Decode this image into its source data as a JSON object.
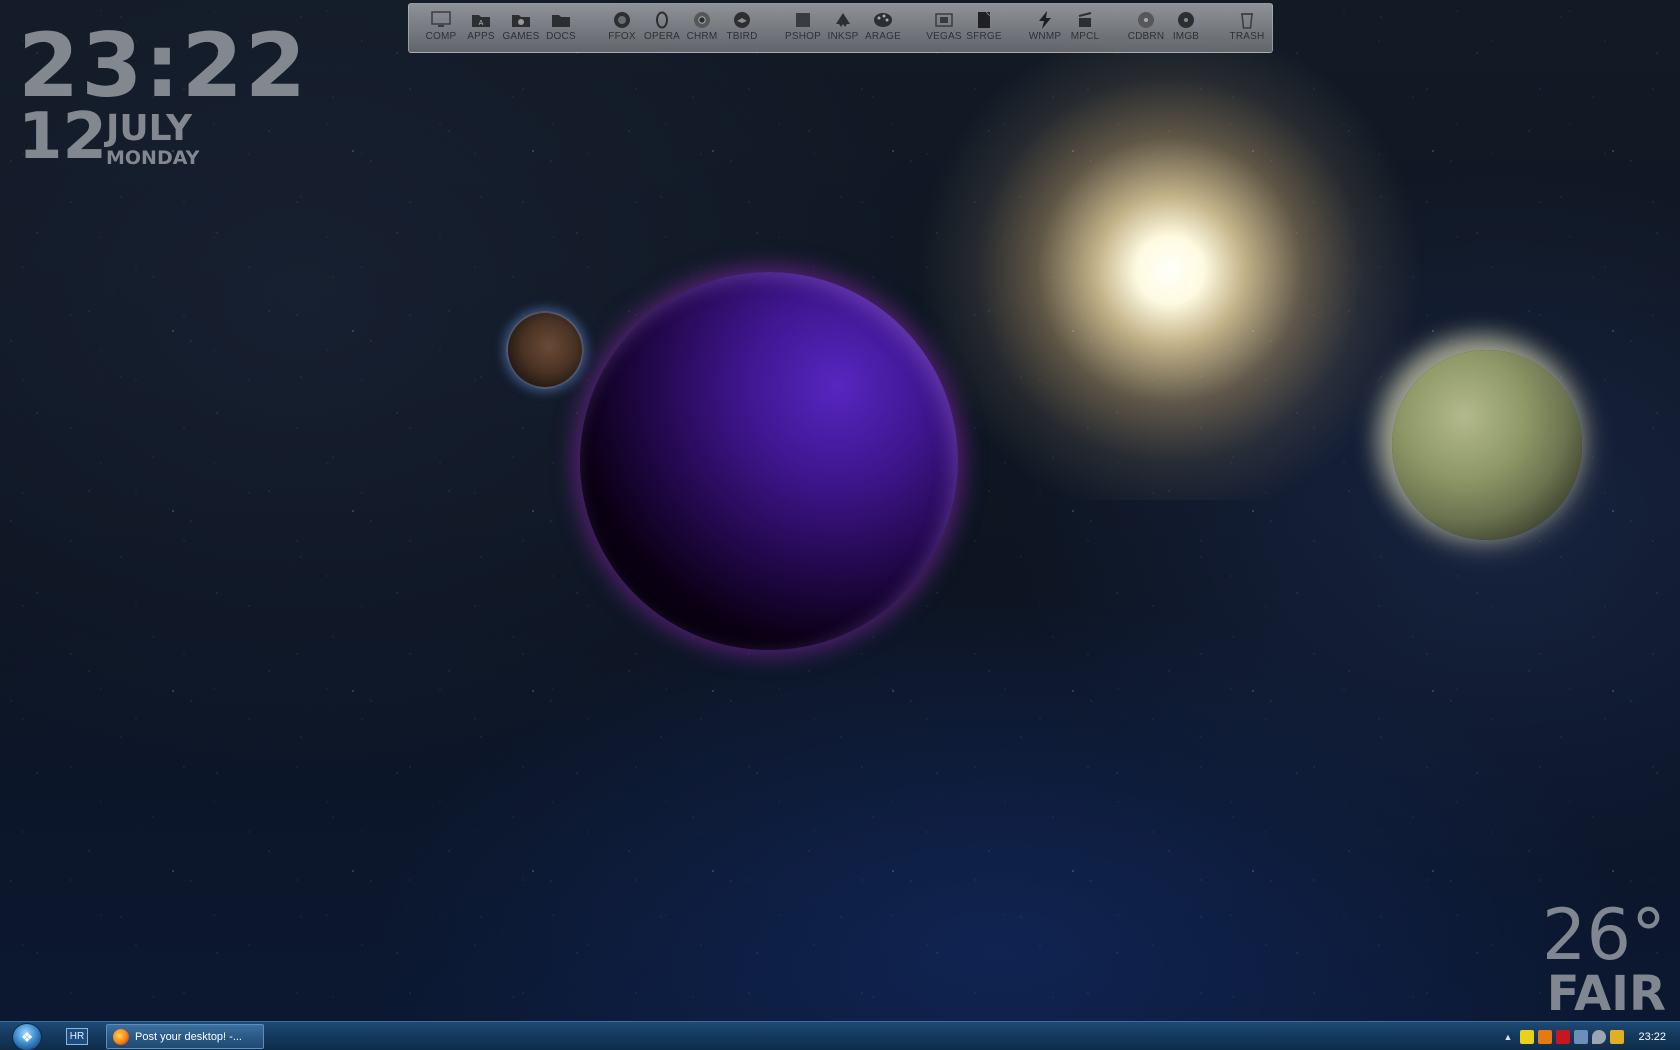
{
  "clock": {
    "time": "23:22",
    "day": "12",
    "month": "JULY",
    "weekday": "MONDAY"
  },
  "dock": {
    "items": [
      {
        "label": "COMP",
        "icon": "monitor-icon"
      },
      {
        "label": "APPS",
        "icon": "apps-folder-icon"
      },
      {
        "label": "GAMES",
        "icon": "games-folder-icon"
      },
      {
        "label": "DOCS",
        "icon": "docs-folder-icon"
      },
      {
        "label": "FFOX",
        "icon": "firefox-icon"
      },
      {
        "label": "OPERA",
        "icon": "opera-icon"
      },
      {
        "label": "CHRM",
        "icon": "chrome-icon"
      },
      {
        "label": "TBIRD",
        "icon": "thunderbird-icon"
      },
      {
        "label": "PSHOP",
        "icon": "photoshop-icon"
      },
      {
        "label": "INKSP",
        "icon": "inkscape-icon"
      },
      {
        "label": "ARAGE",
        "icon": "artrage-icon"
      },
      {
        "label": "VEGAS",
        "icon": "vegas-icon"
      },
      {
        "label": "SFRGE",
        "icon": "soundforge-icon"
      },
      {
        "label": "WNMP",
        "icon": "winamp-icon"
      },
      {
        "label": "MPCL",
        "icon": "media-player-classic-icon"
      },
      {
        "label": "CDBRN",
        "icon": "cd-burner-icon"
      },
      {
        "label": "IMGB",
        "icon": "imgburn-icon"
      },
      {
        "label": "TRASH",
        "icon": "trash-icon"
      }
    ]
  },
  "weather": {
    "temp": "26°",
    "condition": "FAIR"
  },
  "taskbar": {
    "quick_launch_label": "HR",
    "task_label": "Post your desktop! -...",
    "tray_time": "23:22"
  },
  "colors": {
    "taskbar": "#153a5f",
    "widget_text": "#969ba2"
  }
}
